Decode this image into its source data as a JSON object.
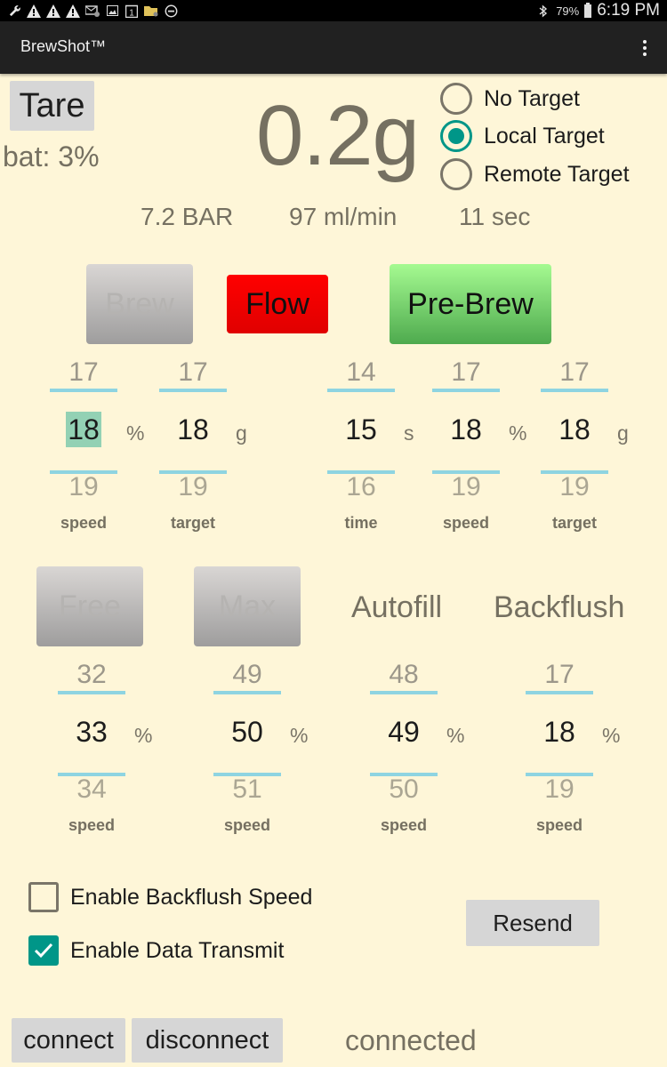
{
  "status_bar": {
    "left_icons": [
      "wrench-icon",
      "warning-icon",
      "warning-icon",
      "warning-icon",
      "email-icon",
      "image-icon",
      "calendar-icon",
      "folder-icon",
      "do-not-disturb-icon"
    ],
    "calendar_day": "1",
    "battery_percent": "79%",
    "time": "6:19 PM"
  },
  "app_bar": {
    "title": "BrewShot™"
  },
  "scale": {
    "tare_label": "Tare",
    "battery": "bat: 3%",
    "weight": "0.2g",
    "pressure": "7.2 BAR",
    "flow_rate": "97 ml/min",
    "elapsed": "11 sec"
  },
  "target_mode": {
    "options": [
      {
        "label": "No Target",
        "selected": false
      },
      {
        "label": "Local Target",
        "selected": true
      },
      {
        "label": "Remote Target",
        "selected": false
      }
    ]
  },
  "modes": {
    "brew": {
      "label": "Brew",
      "enabled": false
    },
    "flow": {
      "label": "Flow",
      "color": "#ff0000"
    },
    "prebrew": {
      "label": "Pre-Brew",
      "color": "#6fcf6a"
    }
  },
  "brew_pickers": [
    {
      "prev": "17",
      "value": "18",
      "next": "19",
      "unit": "%",
      "label": "speed",
      "selected": true
    },
    {
      "prev": "17",
      "value": "18",
      "next": "19",
      "unit": "g",
      "label": "target",
      "selected": false
    }
  ],
  "prebrew_pickers": [
    {
      "prev": "14",
      "value": "15",
      "next": "16",
      "unit": "s",
      "label": "time"
    },
    {
      "prev": "17",
      "value": "18",
      "next": "19",
      "unit": "%",
      "label": "speed"
    },
    {
      "prev": "17",
      "value": "18",
      "next": "19",
      "unit": "g",
      "label": "target"
    }
  ],
  "lower_modes": {
    "free": {
      "label": "Free",
      "enabled": false
    },
    "max": {
      "label": "Max",
      "enabled": false
    },
    "autofill": {
      "label": "Autofill"
    },
    "backflush": {
      "label": "Backflush"
    }
  },
  "lower_pickers": [
    {
      "prev": "32",
      "value": "33",
      "next": "34",
      "unit": "%",
      "label": "speed"
    },
    {
      "prev": "49",
      "value": "50",
      "next": "51",
      "unit": "%",
      "label": "speed"
    },
    {
      "prev": "48",
      "value": "49",
      "next": "50",
      "unit": "%",
      "label": "speed"
    },
    {
      "prev": "17",
      "value": "18",
      "next": "19",
      "unit": "%",
      "label": "speed"
    }
  ],
  "options": {
    "backflush_speed": {
      "label": "Enable Backflush Speed",
      "checked": false
    },
    "data_transmit": {
      "label": "Enable Data Transmit",
      "checked": true
    }
  },
  "actions": {
    "resend": "Resend",
    "connect": "connect",
    "disconnect": "disconnect"
  },
  "connection_status": "connected",
  "colors": {
    "background": "#fef6d8",
    "accent": "#009688",
    "picker_line": "#8ed4e1",
    "selected_value_bg": "#93d1b4"
  }
}
